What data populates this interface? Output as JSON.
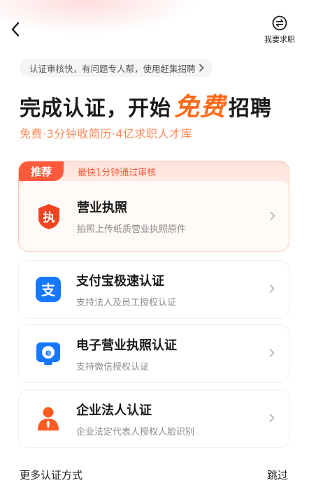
{
  "header": {
    "back_icon": "chevron-left-icon",
    "switch_label": "我要求职",
    "switch_icon": "swap-circle-icon"
  },
  "tip": {
    "text": "认证审核快，有问题专人帮，使用赶集招聘"
  },
  "headline": {
    "part1": "完成认证，开始",
    "highlight": "免费",
    "part2": "招聘"
  },
  "sub_headline": "免费·3分钟收简历·4亿求职人才库",
  "recommend": {
    "tag": "推荐",
    "note": "最快1分钟通过审核"
  },
  "methods": [
    {
      "title": "营业执照",
      "desc": "拍照上传纸质营业执照原件",
      "icon": "business-license-icon",
      "color": "#f0441f"
    },
    {
      "title": "支付宝极速认证",
      "desc": "支持法人及员工授权认证",
      "icon": "alipay-icon",
      "color": "#1677ff"
    },
    {
      "title": "电子营业执照认证",
      "desc": "支持微信授权认证",
      "icon": "e-license-icon",
      "color": "#1677ff"
    },
    {
      "title": "企业法人认证",
      "desc": "企业法定代表人授权人脸识别",
      "icon": "legal-person-icon",
      "color": "#ff5a1f"
    }
  ],
  "footer": {
    "more": "更多认证方式",
    "skip": "跳过"
  },
  "colors": {
    "accent": "#ff6a1a",
    "recommend": "#ff5a3c"
  }
}
